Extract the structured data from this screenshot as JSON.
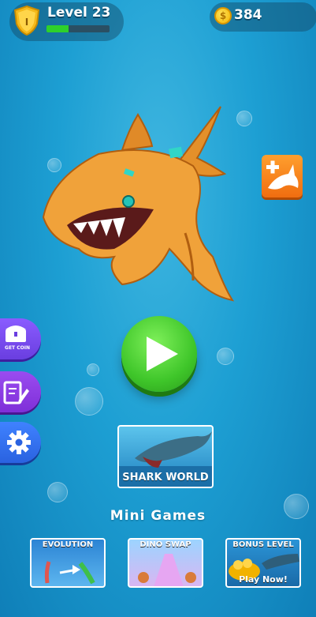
{
  "header": {
    "rank_badge": "I",
    "level_label": "Level 23",
    "xp_progress": 0.35,
    "coin_symbol": "$",
    "coins": "384"
  },
  "side_menu": {
    "get_coin_label": "GET COIN"
  },
  "main": {
    "shark_world_label": "SHARK WORLD"
  },
  "mini_games": {
    "title": "Mini Games",
    "cards": [
      {
        "label": "EVOLUTION"
      },
      {
        "label": "DINO SWAP"
      },
      {
        "label": "BONUS LEVEL",
        "cta": "Play Now!"
      }
    ]
  },
  "colors": {
    "accent_green": "#3fc62a",
    "add_shark_orange": "#f06d10",
    "menu_purple": "#7f2fd8",
    "settings_blue": "#2a62e0"
  }
}
